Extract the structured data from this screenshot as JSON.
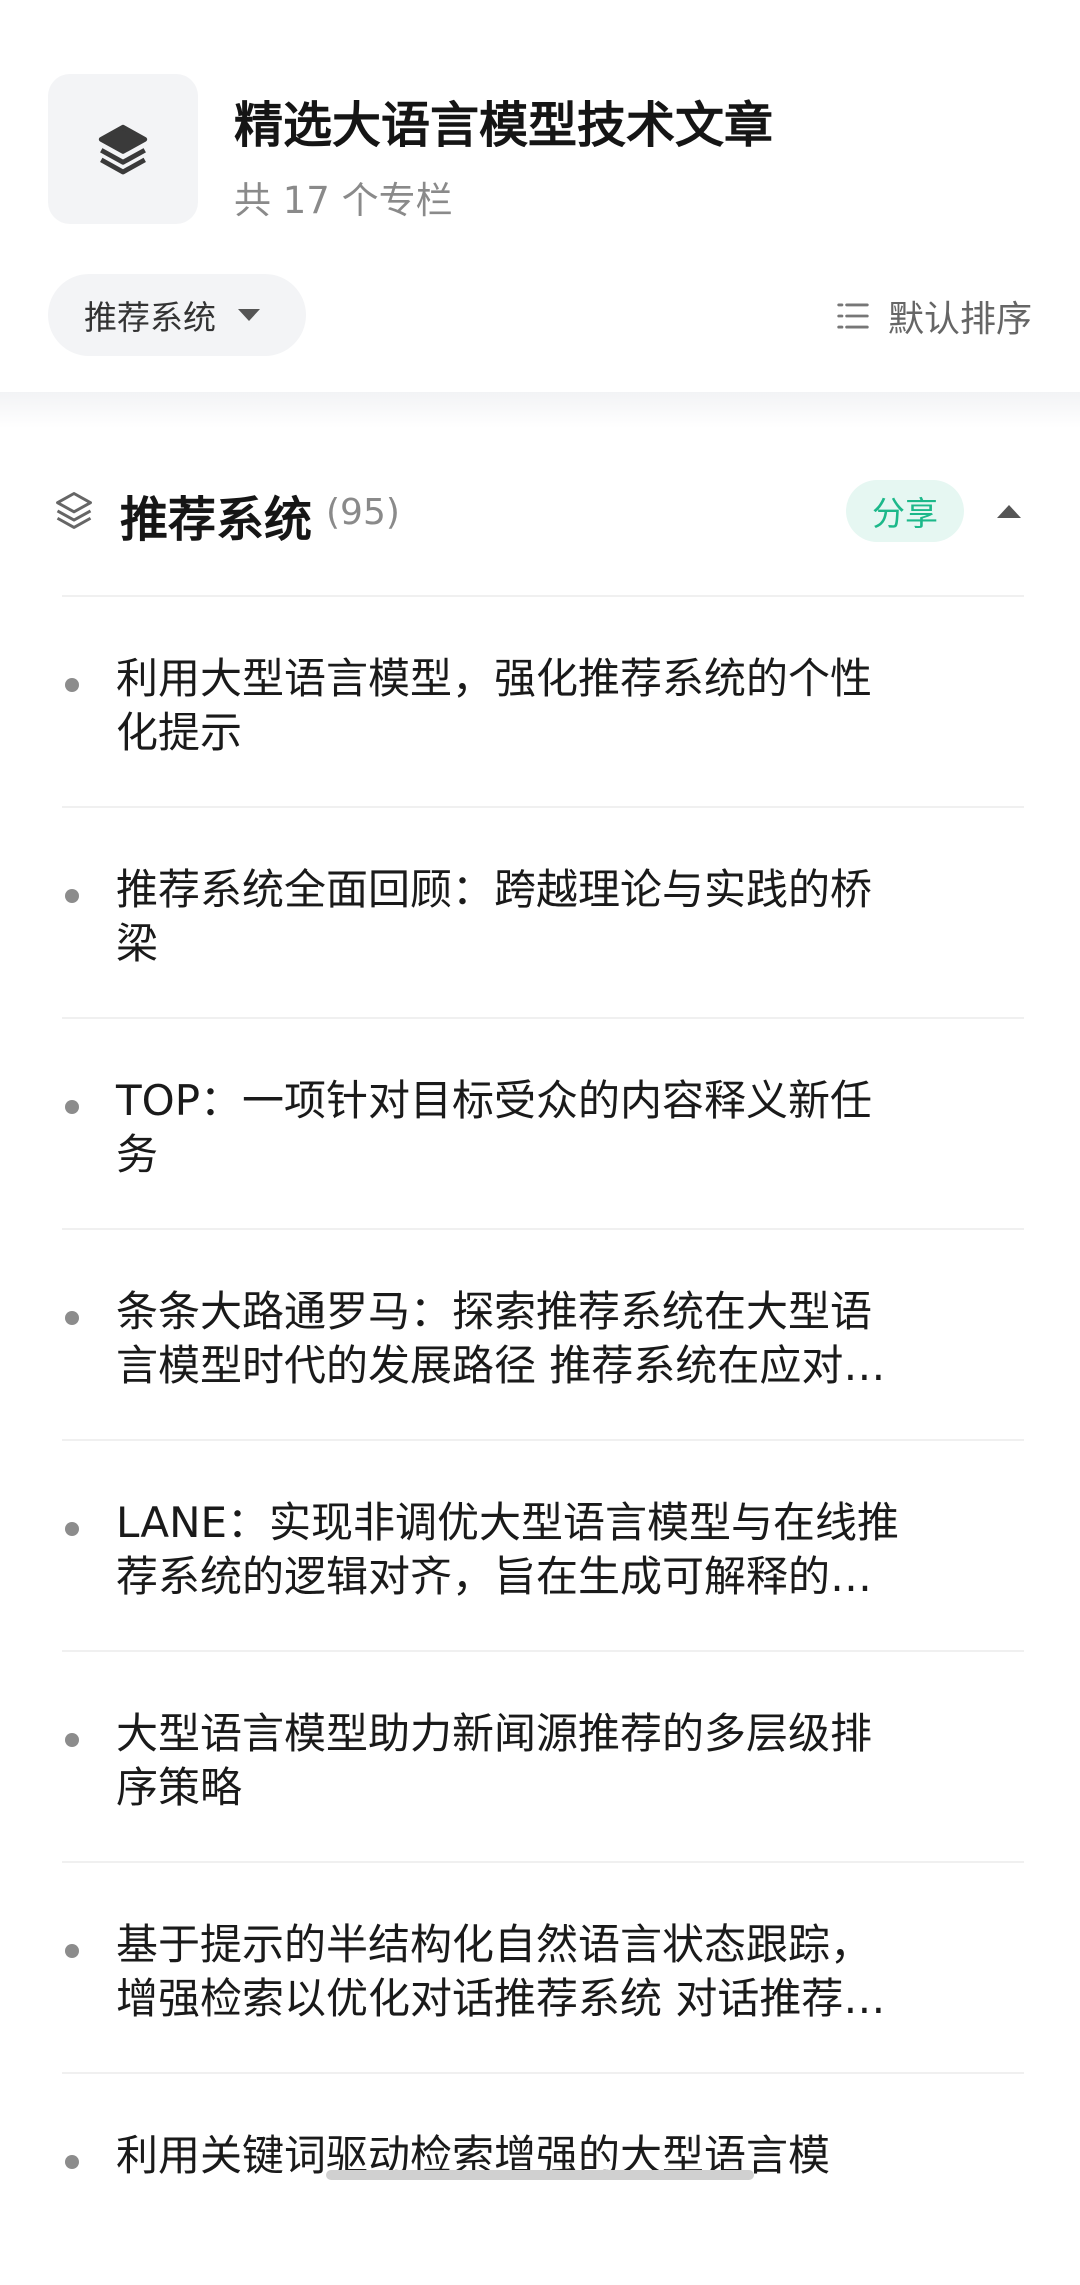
{
  "collection": {
    "title": "精选大语言模型技术文章",
    "count_text": "共 17 个专栏",
    "icon": "layers-icon"
  },
  "filter": {
    "selected": "推荐系统",
    "caret_icon": "caret-down-icon"
  },
  "sort": {
    "label": "默认排序",
    "icon": "list-icon"
  },
  "section": {
    "title": "推荐系统",
    "count": "(95)",
    "share_label": "分享",
    "icon": "layers-outline-icon",
    "collapse_icon": "caret-up-icon"
  },
  "colors": {
    "accent": "#1db88a",
    "accent_bg": "#e6f7f2",
    "text": "#1a1a1a",
    "muted": "#8a8a8a"
  },
  "articles": [
    {
      "title": "利用大型语言模型，强化推荐系统的个性\n化提示"
    },
    {
      "title": "推荐系统全面回顾：跨越理论与实践的桥\n梁"
    },
    {
      "title": "TOP：一项针对目标受众的内容释义新任\n务"
    },
    {
      "title": "条条大路通罗马：探索推荐系统在大型语\n言模型时代的发展路径 推荐系统在应对…"
    },
    {
      "title": "LANE：实现非调优大型语言模型与在线推\n荐系统的逻辑对齐，旨在生成可解释的…"
    },
    {
      "title": "大型语言模型助力新闻源推荐的多层级排\n序策略"
    },
    {
      "title": "基于提示的半结构化自然语言状态跟踪，\n增强检索以优化对话推荐系统 对话推荐…"
    },
    {
      "title": "利用关键词驱动检索增强的大型语言模"
    }
  ]
}
